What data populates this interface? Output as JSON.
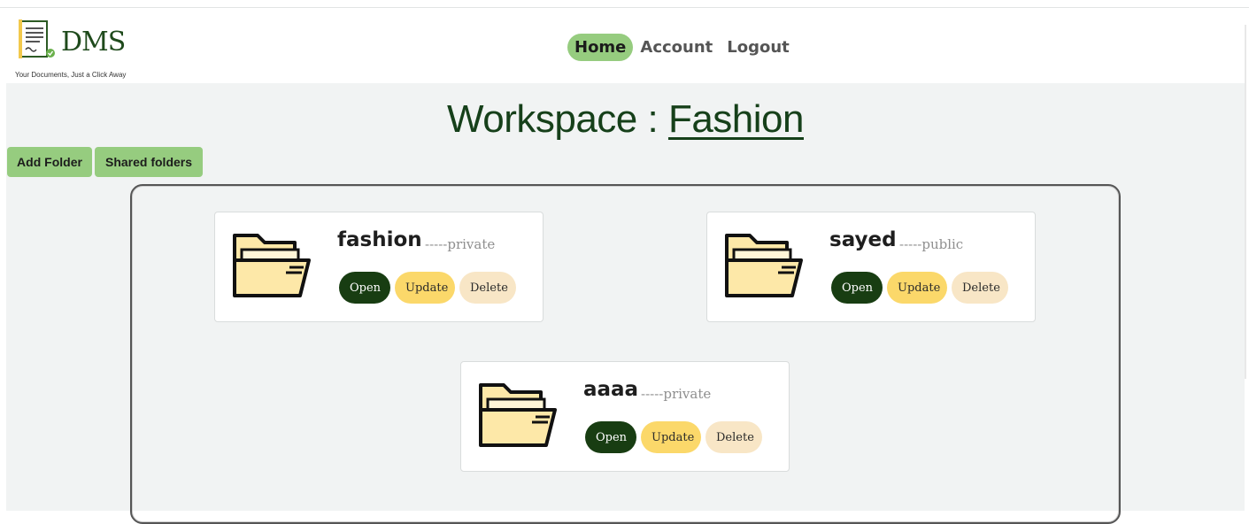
{
  "app": {
    "logo_text": "DMS",
    "tagline": "Your Documents, Just a Click Away"
  },
  "nav": {
    "items": [
      {
        "label": "Home",
        "active": true
      },
      {
        "label": "Account",
        "active": false
      },
      {
        "label": "Logout",
        "active": false
      }
    ]
  },
  "page": {
    "title_prefix": "Workspace : ",
    "workspace_name": "Fashion"
  },
  "toolbar": {
    "add_folder_label": "Add Folder",
    "shared_folders_label": "Shared folders"
  },
  "folders": [
    {
      "name": "fashion",
      "visibility": "-----private",
      "open_label": "Open",
      "update_label": "Update",
      "delete_label": "Delete"
    },
    {
      "name": "sayed",
      "visibility": "-----public",
      "open_label": "Open",
      "update_label": "Update",
      "delete_label": "Delete"
    },
    {
      "name": "aaaa",
      "visibility": "-----private",
      "open_label": "Open",
      "update_label": "Update",
      "delete_label": "Delete"
    }
  ],
  "icons": {
    "folder": "folder-open-icon",
    "logo": "document-logo-icon"
  },
  "colors": {
    "accent_green": "#96cc7f",
    "dark_green": "#183d12",
    "update_yellow": "#fbd86a",
    "delete_beige": "#f8e6c6",
    "folder_fill": "#fde8a8"
  }
}
